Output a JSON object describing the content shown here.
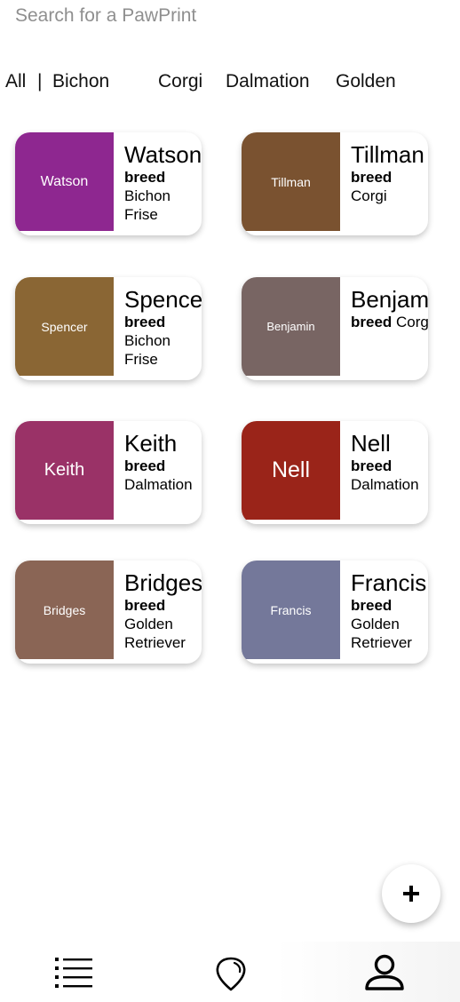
{
  "search": {
    "placeholder": "Search for a PawPrint"
  },
  "filters": {
    "all": "All",
    "separator": "|",
    "bichon": "Bichon",
    "corgi": "Corgi",
    "dalmation": "Dalmation",
    "golden": "Golden"
  },
  "pets": [
    {
      "name": "Watson",
      "swatch_label": "Watson",
      "breed_label": "breed",
      "breed_line1": "Bichon",
      "breed_line2": "Frise",
      "color": "#8e2790"
    },
    {
      "name": "Tillman",
      "swatch_label": "Tillman",
      "breed_label": "breed",
      "breed_line1": "Corgi",
      "breed_line2": "",
      "color": "#7a5230"
    },
    {
      "name": "Spencer",
      "swatch_label": "Spencer",
      "breed_label": "breed",
      "breed_line1": "Bichon",
      "breed_line2": "Frise",
      "color": "#8a6634"
    },
    {
      "name": "Benjamin",
      "swatch_label": "Benjamin",
      "breed_label": "breed",
      "breed_inline": "Corgi",
      "color": "#786563"
    },
    {
      "name": "Keith",
      "swatch_label": "Keith",
      "breed_label": "breed",
      "breed_line1": "Dalmation",
      "breed_line2": "",
      "color": "#9a3267"
    },
    {
      "name": "Nell",
      "swatch_label": "Nell",
      "breed_label": "breed",
      "breed_line1": "Dalmation",
      "breed_line2": "",
      "color": "#9a2419"
    },
    {
      "name": "Bridges",
      "swatch_label": "Bridges",
      "breed_label": "breed",
      "breed_line1": "Golden",
      "breed_line2": "Retriever",
      "color": "#8a6555"
    },
    {
      "name": "Francis",
      "swatch_label": "Francis",
      "breed_label": "breed",
      "breed_line1": "Golden",
      "breed_line2": "Retriever",
      "color": "#74789a"
    }
  ],
  "fab": {
    "icon": "plus-icon",
    "label": "+"
  },
  "bottom_nav": [
    {
      "icon": "list-icon"
    },
    {
      "icon": "map-pin-icon"
    },
    {
      "icon": "profile-icon"
    }
  ]
}
